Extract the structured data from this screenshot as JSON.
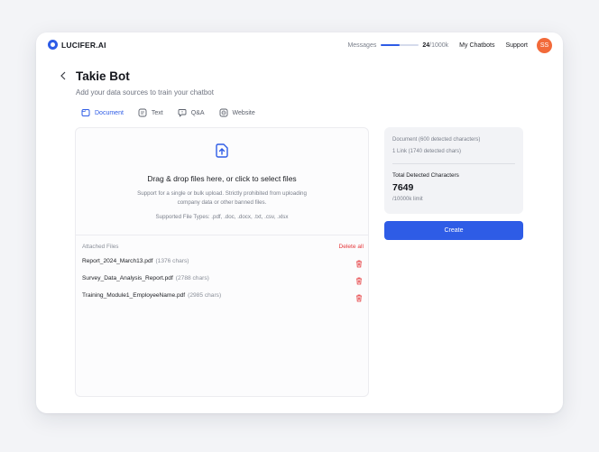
{
  "brand": {
    "name": "LUCIFER.AI"
  },
  "topnav": {
    "messages_label": "Messages",
    "messages_used": "24",
    "messages_total": "/1000k",
    "messages_progress": 0.5,
    "chatbots": "My Chatbots",
    "support": "Support",
    "avatar_initials": "SS"
  },
  "header": {
    "back_icon": "chevron-left-icon",
    "title": "Takie Bot",
    "subtitle": "Add your data sources to train your chatbot"
  },
  "tabs": [
    {
      "label": "Document",
      "icon": "document-icon",
      "active": true
    },
    {
      "label": "Text",
      "icon": "text-icon",
      "active": false
    },
    {
      "label": "Q&A",
      "icon": "chat-bubble-icon",
      "active": false
    },
    {
      "label": "Website",
      "icon": "globe-icon",
      "active": false
    }
  ],
  "upload": {
    "icon": "upload-icon",
    "title": "Drag & drop files here, or click to select files",
    "subtitle": "Support for a single or bulk upload. Strictly prohibited from uploading company data or other banned files.",
    "types": "Supported File Types: .pdf, .doc, .docx, .txt, .csv, .xlsx"
  },
  "files": {
    "label": "Attached Files",
    "delete_all": "Delete all",
    "items": [
      {
        "name": "Report_2024_March13.pdf",
        "size": "(1376 chars)"
      },
      {
        "name": "Survey_Data_Analysis_Report.pdf",
        "size": "(2788 chars)"
      },
      {
        "name": "Training_Module1_EmployeeName.pdf",
        "size": "(2985 chars)"
      }
    ]
  },
  "summary": {
    "document_line": "Document (600 detected characters)",
    "link_line": "1 Link (1740 detected chars)",
    "total_label": "Total Detected Characters",
    "total_value": "7649",
    "limit": "/10000k limit"
  },
  "create_button": "Create",
  "colors": {
    "accent": "#2e5ce6",
    "danger": "#e5383b",
    "avatar": "#f26a3a"
  }
}
